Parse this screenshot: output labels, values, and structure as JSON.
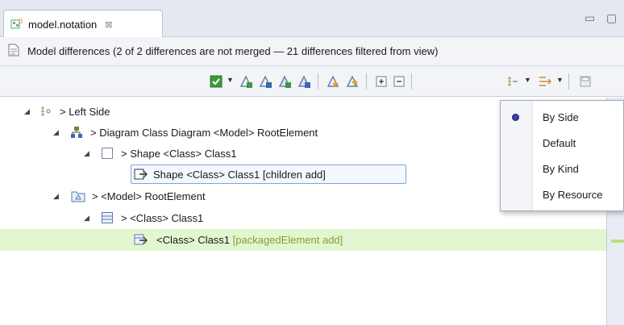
{
  "tab": {
    "title": "model.notation",
    "close_glyph": "⊠"
  },
  "window_controls": {
    "minimize": "▭",
    "maximize": "▢"
  },
  "header": {
    "text": "Model differences  (2 of 2 differences are not merged — 21 differences filtered from view)"
  },
  "toolbar": {
    "icons": [
      "merge-checked-icon",
      "copy-left-to-right-icon",
      "copy-all-left-to-right-icon",
      "copy-right-to-left-icon",
      "copy-all-right-to-left-icon",
      "next-difference-icon",
      "previous-difference-icon",
      "expand-all-icon",
      "collapse-all-icon",
      "group-by-icon",
      "filter-icon",
      "save-icon"
    ],
    "dropdown_glyph": "▼"
  },
  "tree": {
    "rows": [
      {
        "label": "> Left Side"
      },
      {
        "label": "> Diagram Class Diagram <Model> RootElement"
      },
      {
        "label": "> Shape <Class> Class1"
      },
      {
        "label": "Shape <Class> Class1 [children add]"
      },
      {
        "label": "> <Model> RootElement"
      },
      {
        "label": "> <Class> Class1"
      },
      {
        "label": "<Class> Class1",
        "meta": "[packagedElement add]"
      }
    ],
    "expanded_glyph": "◢"
  },
  "menu": {
    "items": [
      {
        "label": "By Side",
        "selected": true
      },
      {
        "label": "Default",
        "selected": false
      },
      {
        "label": "By Kind",
        "selected": false
      },
      {
        "label": "By Resource",
        "selected": false
      }
    ]
  },
  "colors": {
    "highlight": "#e2f6cf",
    "selection_border": "#7fa5d8",
    "meta_text": "#8a9a3a",
    "radio": "#3a3f9e"
  }
}
